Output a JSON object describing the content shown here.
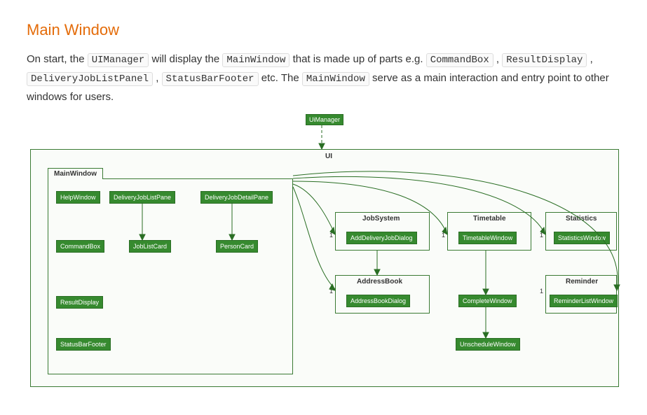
{
  "heading": "Main Window",
  "para_parts": {
    "t1": "On start, the ",
    "c1": "UIManager",
    "t2": " will display the ",
    "c2": "MainWindow",
    "t3": " that is made up of parts e.g. ",
    "c3": "CommandBox",
    "t4": ", ",
    "c4": "ResultDisplay",
    "t5": ", ",
    "c5": "DeliveryJobListPanel",
    "t6": ", ",
    "c6": "StatusBarFooter",
    "t7": " etc. The ",
    "c7": "MainWindow",
    "t8": " serve as a main interaction and entry point to other windows for users."
  },
  "diagram": {
    "root_label": "UiManager",
    "ui_pkg": "UI",
    "mainwindow_pkg": "MainWindow",
    "jobsystem_pkg": "JobSystem",
    "addressbook_pkg": "AddressBook",
    "timetable_pkg": "Timetable",
    "statistics_pkg": "Statistics",
    "reminder_pkg": "Reminder",
    "cls": {
      "helpwindow": "HelpWindow",
      "deliveryjoblistpane": "DeliveryJobListPane",
      "deliveryjobdetailpane": "DeliveryJobDetailPane",
      "commandbox": "CommandBox",
      "joblistcard": "JobListCard",
      "personcard": "PersonCard",
      "resultdisplay": "ResultDisplay",
      "statusbarfooter": "StatusBarFooter",
      "adddeliveryjobdialog": "AddDeliveryJobDialog",
      "addressbookdialog": "AddressBookDialog",
      "timetablewindow": "TimetableWindow",
      "completewindow": "CompleteWindow",
      "unschedulewindow": "UnscheduleWindow",
      "statisticswindow": "StatisticsWindow",
      "reminderlistwindow": "ReminderListWindow"
    },
    "mult": "1"
  }
}
